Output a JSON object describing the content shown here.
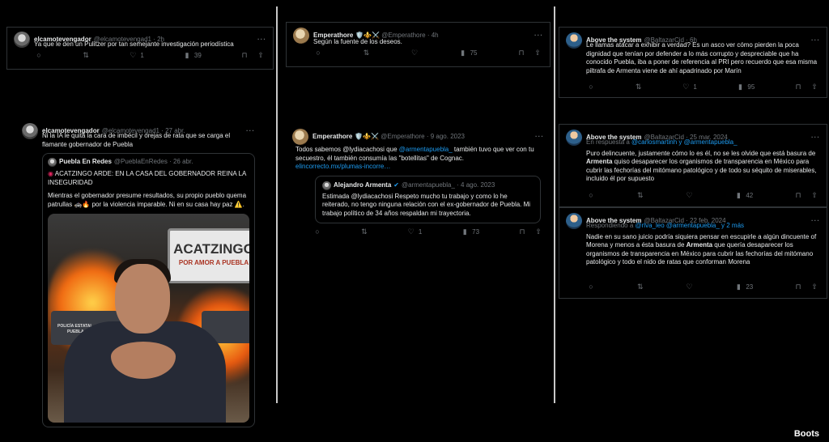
{
  "watermark": "Boots",
  "tweets": {
    "t1": {
      "name": "elcamotevengador",
      "handle": "@elcamotevengad1 · 2h",
      "text": "Ya que le den un Pulitzer por tan semejante investigación periodística",
      "reply_count": "",
      "retweet_count": "",
      "like_count": "1",
      "views": "39"
    },
    "t2": {
      "name": "elcamotevengador",
      "handle": "@elcamotevengad1 · 27 abr.",
      "text": "Ni la IA le quita la cara de imbécil y orejas de rata que se carga el flamante gobernador de Puebla",
      "quote": {
        "name": "Puebla En Redes",
        "handle": "@PueblaEnRedes · 26 abr.",
        "line1": "ACATZINGO ARDE: EN LA CASA DEL GOBERNADOR REINA LA INSEGURIDAD",
        "line2": "Mientras el gobernador presume resultados, su propio pueblo quema patrullas 🚓🔥 por la violencia imparable. Ni en su casa hay paz ⚠️.",
        "sign_title": "ACATZINGO",
        "sign_sub": "POR AMOR A PUEBLA",
        "car_label": "POLICÍA ESTATAL",
        "car_sub": "PUEBLA"
      }
    },
    "t3": {
      "name": "Emperathore",
      "badges": "🛡️⚜️⚔️",
      "handle": "@Emperathore · 4h",
      "text": "Según la fuente de los deseos.",
      "views": "75"
    },
    "t4": {
      "name": "Emperathore",
      "badges": "🛡️⚜️⚔️",
      "handle": "@Emperathore · 9 ago. 2023",
      "text_pre": "Todos sabemos @lydiacachosi que ",
      "text_link": "@armentapuebla_",
      "text_post": " también tuvo que ver con tu secuestro, él también consumía las \"botellitas\" de Cognac.",
      "url": "elincorrecto.mx/plumas-incorre…",
      "quote": {
        "name": "Alejandro Armenta",
        "handle": "@armentapuebla_ · 4 ago. 2023",
        "text": "Estimada @lydiacachosi Respeto mucho tu trabajo y como lo he reiterado, no tengo ninguna relación con el ex-gobernador de Puebla. Mi trabajo político de 34 años respaldan mi trayectoria."
      },
      "like_count": "1",
      "views": "73"
    },
    "t5": {
      "name": "Above the system",
      "handle": "@BaltazarCid · 6h",
      "text": "Le llamas atacar a exhibir a verdad? Es un asco ver cómo pierden la poca dignidad que tenían por defender a lo más corrupto y despreciable que ha conocido Puebla, iba a poner de referencia al PRI pero recuerdo que esa misma piltrafa de Armenta viene de ahí apadrinado por Marín",
      "like_count": "1",
      "views": "95"
    },
    "t6": {
      "name": "Above the system",
      "handle": "@BaltazarCid · 25 mar. 2024",
      "reply_pre": "En respuesta a ",
      "reply_link": "@carlosmartinh y @armentapuebla_",
      "text_pre": "Puro delincuente, justamente cómo lo es él, no se les olvide que está basura de ",
      "text_bold": "Armenta",
      "text_post": " quiso desaparecer los organismos de transparencia en México para cubrir las fechorías del mitómano patológico y de todo su séquito de miserables, incluido él por supuesto",
      "views": "42"
    },
    "t7": {
      "name": "Above the system",
      "handle": "@BaltazarCid · 22 feb. 2024",
      "reply_pre": "Respondiendo a ",
      "reply_link": "@rlva_leo @armentapuebla_ y 2 más",
      "text_pre": "Nadie en su sano juicio podría siquiera pensar en escupirle a algún dincuente of Morena y menos a ésta basura de ",
      "text_bold": "Armenta",
      "text_post": " que quería desaparecer los organismos de transparencia en México para cubrir las fechorías del mitómano patológico y todo el nido de ratas que conforman Morena",
      "views": "23"
    }
  }
}
